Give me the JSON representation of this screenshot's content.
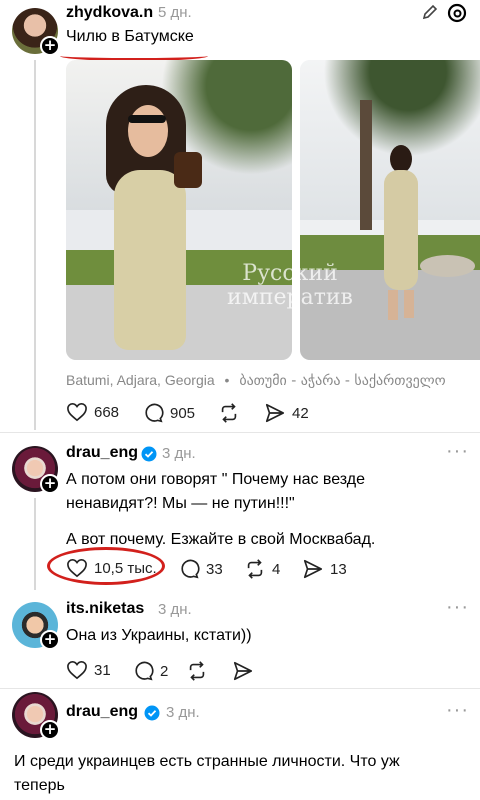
{
  "post1": {
    "username": "zhydkova.n",
    "time": "5 дн.",
    "text": "Чилю в Батумске",
    "location": "Batumi, Adjara, Georgia",
    "location_local": "ბათუმი - აჭარა - საქართველო",
    "watermark_line1": "Русский",
    "watermark_line2": "императив",
    "likes": "668",
    "replies": "905",
    "sends": "42",
    "icons": [
      "pencil-icon",
      "threads-logo-icon"
    ]
  },
  "post2": {
    "username": "drau_eng",
    "time": "3 дн.",
    "text_line1": "А потом они говорят \" Почему нас везде",
    "text_line2": "ненавидят?! Мы — не путин!!!\"",
    "text_line3": "А вот почему. Езжайте в свой Москвабад.",
    "likes": "10,5 тыс.",
    "replies": "33",
    "reposts": "4",
    "sends": "13"
  },
  "post3": {
    "username": "its.niketas",
    "time": "3 дн.",
    "text": "Она из Украины, кстати))",
    "likes": "31",
    "replies": "2"
  },
  "post4": {
    "username": "drau_eng",
    "time": "3 дн.",
    "text_line1": "И среди украинцев есть странные личности. Что уж",
    "text_line2": "теперь"
  },
  "colors": {
    "accent_red": "#d2201c",
    "verified_blue": "#0095f6",
    "muted": "#999999"
  }
}
